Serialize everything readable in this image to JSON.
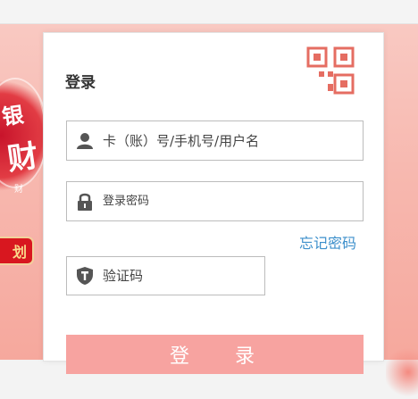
{
  "login": {
    "title": "登录",
    "account_placeholder": "卡（账）号/手机号/用户名",
    "password_placeholder": "登录密码",
    "captcha_placeholder": "验证码",
    "forgot_link": "忘记密码",
    "login_button": "登 录",
    "qr_icon": "qr-code-icon"
  },
  "banner": {
    "seal_top": "银",
    "seal_middle": "财",
    "seal_small": "财",
    "plan_badge": "划"
  },
  "colors": {
    "banner_bg": "#f7b8af",
    "login_button": "#f7a3a0",
    "link": "#3c8fcb",
    "qr_accent": "#e56d62"
  }
}
